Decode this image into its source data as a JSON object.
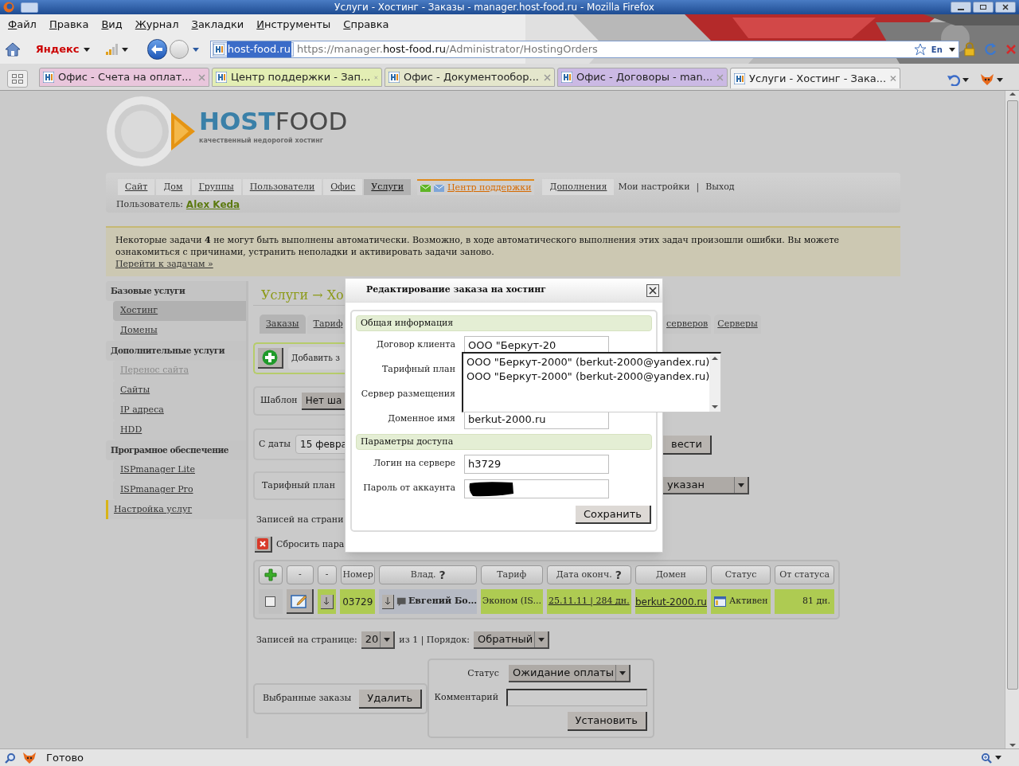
{
  "window": {
    "title": "Услуги - Хостинг - Заказы - manager.host-food.ru - Mozilla Firefox"
  },
  "menu": [
    "Файл",
    "Правка",
    "Вид",
    "Журнал",
    "Закладки",
    "Инструменты",
    "Справка"
  ],
  "toolbar": {
    "search_engine": "Яндекс",
    "site_label": "host-food.ru",
    "url_start": "https://manager.",
    "url_domain": "host-food.ru",
    "url_path": "/Administrator/HostingOrders",
    "keyboard_layout": "En"
  },
  "browser_tabs": [
    {
      "label": "Офис - Счета на оплат...",
      "selected": false,
      "color": "#e9c6dc"
    },
    {
      "label": "Центр поддержки - Зап...",
      "selected": false,
      "color": "#e3eeb4"
    },
    {
      "label": "Офис - Документообор...",
      "selected": false,
      "color": "#e4e6cc"
    },
    {
      "label": "Офис - Договоры - man...",
      "selected": false,
      "color": "#cbb9e4"
    },
    {
      "label": "Услуги - Хостинг - Зака...",
      "selected": true,
      "color": "#f2f2f2"
    }
  ],
  "site": {
    "logo_first": "HOST",
    "logo_second": "FOOD",
    "tagline": "качественный недорогой хостинг"
  },
  "nav": [
    {
      "label": "Сайт",
      "kind": "link",
      "selected": false
    },
    {
      "label": "Дом",
      "kind": "link",
      "selected": false
    },
    {
      "label": "Группы",
      "kind": "link",
      "selected": false
    },
    {
      "label": "Пользователи",
      "kind": "link",
      "selected": false
    },
    {
      "label": "Офис",
      "kind": "link",
      "selected": false
    },
    {
      "label": "Услуги",
      "kind": "link",
      "selected": true
    },
    {
      "label": "Центр поддержки",
      "kind": "support",
      "selected": false
    },
    {
      "label": "Дополнения",
      "kind": "link",
      "selected": false
    },
    {
      "label": "Мои настройки",
      "kind": "plain"
    },
    {
      "label": "|",
      "kind": "separator"
    },
    {
      "label": "Выход",
      "kind": "plain"
    }
  ],
  "user": {
    "label": "Пользователь:",
    "name": "Alex Keda"
  },
  "notice": {
    "text": "Некоторые задачи **4** не могут быть выполнены автоматически. Возможно, в ходе автоматического выполнения этих задач произошли ошибки. Вы можете ознакомиться с причинами, устранить неполадки и активировать задачи заново.",
    "link": "Перейти к задачам »"
  },
  "sidebar": [
    {
      "label": "Базовые услуги",
      "kind": "header",
      "selected": false,
      "disabled": false
    },
    {
      "label": "Хостинг",
      "kind": "item",
      "selected": true,
      "disabled": false
    },
    {
      "label": "Домены",
      "kind": "item",
      "selected": false,
      "disabled": false
    },
    {
      "label": "Дополнительные услуги",
      "kind": "header",
      "selected": false,
      "disabled": false
    },
    {
      "label": "Перенос сайта",
      "kind": "item",
      "selected": false,
      "disabled": true
    },
    {
      "label": "Сайты",
      "kind": "item",
      "selected": false,
      "disabled": false
    },
    {
      "label": "IP адреса",
      "kind": "item",
      "selected": false,
      "disabled": false
    },
    {
      "label": "HDD",
      "kind": "item",
      "selected": false,
      "disabled": false
    },
    {
      "label": "Програмное обеспечение",
      "kind": "header",
      "selected": false,
      "disabled": false
    },
    {
      "label": "ISPmanager Lite",
      "kind": "item",
      "selected": false,
      "disabled": false
    },
    {
      "label": "ISPmanager Pro",
      "kind": "item",
      "selected": false,
      "disabled": false
    },
    {
      "label": "Настройка услуг",
      "kind": "marked",
      "selected": false,
      "disabled": false
    }
  ],
  "content": {
    "breadcrumb": "Услуги → Хо",
    "subtabs_before": [
      {
        "label": "Заказы",
        "selected": true
      },
      {
        "label": "Тариф",
        "selected": false
      }
    ],
    "subtabs_after": [
      {
        "label": "серверов",
        "selected": false
      },
      {
        "label": "Серверы",
        "selected": false
      }
    ],
    "add_button": "Добавить з",
    "template": {
      "label": "Шаблон",
      "value": "Нет ша"
    },
    "date_filter": {
      "label": "С даты",
      "value": "15 февра",
      "button": "вести"
    },
    "plan_filter": {
      "label": "Тарифный план",
      "value": "указан"
    },
    "records_top": "Записей на страни",
    "reset": "Сбросить пара"
  },
  "table": {
    "columns": [
      {
        "kind": "add"
      },
      {
        "kind": "text",
        "label": "-"
      },
      {
        "kind": "text",
        "label": "-"
      },
      {
        "kind": "text",
        "label": "Номер"
      },
      {
        "kind": "text",
        "label": "Влад.",
        "help": "?"
      },
      {
        "kind": "text",
        "label": "Тариф"
      },
      {
        "kind": "text",
        "label": "Дата оконч.",
        "help": "?"
      },
      {
        "kind": "text",
        "label": "Домен"
      },
      {
        "kind": "text",
        "label": "Статус"
      },
      {
        "kind": "text",
        "label": "От статуса"
      }
    ],
    "rows": [
      {
        "checked": false,
        "number": "03729",
        "owner": "Евгений Бо...",
        "tariff": "Эконом (IS...",
        "end_date": "25.11.11 | 284 дн.",
        "domain": "berkut-2000.ru",
        "status": "Активен",
        "since_status": "81 дн."
      }
    ]
  },
  "pager": {
    "label": "Записей на странице:",
    "per_page": "20",
    "of": "из 1 | Порядок:",
    "order": "Обратный"
  },
  "bulk": {
    "label": "Выбранные заказы",
    "button": "Удалить"
  },
  "status_form": {
    "status_label": "Статус",
    "status_value": "Ожидание оплаты",
    "comment_label": "Комментарий",
    "button": "Установить"
  },
  "dialog": {
    "title": "Редактирование заказа на хостинг",
    "sections": [
      {
        "title": "Общая информация",
        "fields": [
          {
            "label": "Договор клиента",
            "kind": "text",
            "value": "ООО \"Беркут-20"
          },
          {
            "label": "Тарифный план",
            "kind": "covered"
          },
          {
            "label": "Сервер размещения",
            "kind": "covered"
          },
          {
            "label": "Доменное имя",
            "kind": "text",
            "value": "berkut-2000.ru"
          }
        ]
      },
      {
        "title": "Параметры доступа",
        "fields": [
          {
            "label": "Логин на сервере",
            "kind": "text",
            "value": "h3729"
          },
          {
            "label": "Пароль от аккаунта",
            "kind": "redacted"
          }
        ]
      }
    ],
    "suggestions": [
      "ООО \"Беркут-2000\" (berkut-2000@yandex.ru)",
      "ООО \"Беркут-2000\" (berkut-2000@yandex.ru)"
    ],
    "save": "Сохранить"
  },
  "status_bar": {
    "text": "Готово"
  }
}
